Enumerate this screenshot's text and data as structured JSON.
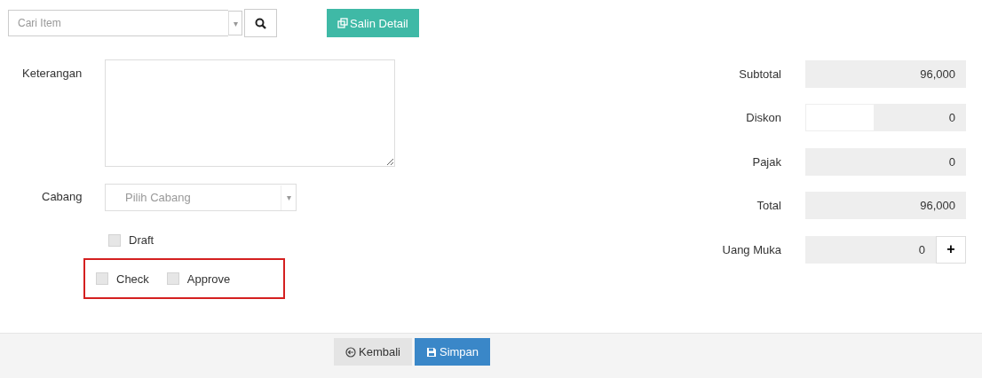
{
  "search": {
    "placeholder": "Cari Item",
    "caret": "▾"
  },
  "copy_button": {
    "label": "Salin Detail"
  },
  "notes": {
    "label": "Keterangan"
  },
  "branch": {
    "label": "Cabang",
    "placeholder": "Pilih Cabang",
    "caret": "▾"
  },
  "draft": {
    "label": "Draft",
    "checked": false
  },
  "approvals": [
    {
      "label": "Check",
      "checked": false
    },
    {
      "label": "Approve",
      "checked": false
    }
  ],
  "totals": [
    {
      "kind": "readonly",
      "label": "Subtotal",
      "value": "96,000"
    },
    {
      "kind": "discount",
      "label": "Diskon",
      "value": "0"
    },
    {
      "kind": "readonly",
      "label": "Pajak",
      "value": "0"
    },
    {
      "kind": "readonly",
      "label": "Total",
      "value": "96,000"
    },
    {
      "kind": "addon",
      "label": "Uang Muka",
      "value": "0",
      "addon": "+"
    }
  ],
  "footer": {
    "back": "Kembali",
    "save": "Simpan"
  }
}
